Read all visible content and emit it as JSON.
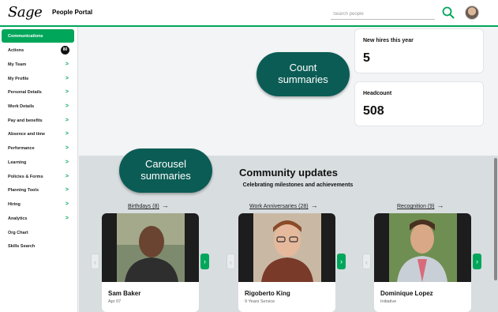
{
  "header": {
    "logo": "Sage",
    "app_name": "People Portal",
    "search_placeholder": "Search people"
  },
  "sidebar": {
    "items": [
      {
        "label": "Communications",
        "active": true
      },
      {
        "label": "Actions",
        "badge": "80"
      },
      {
        "label": "My Team",
        "chevron": ">"
      },
      {
        "label": "My Profile",
        "chevron": ">"
      },
      {
        "label": "Personal Details",
        "chevron": ">"
      },
      {
        "label": "Work Details",
        "chevron": ">"
      },
      {
        "label": "Pay and benefits",
        "chevron": ">"
      },
      {
        "label": "Absence and time",
        "chevron": ">"
      },
      {
        "label": "Performance",
        "chevron": ">"
      },
      {
        "label": "Learning",
        "chevron": ">"
      },
      {
        "label": "Policies & Forms",
        "chevron": ">"
      },
      {
        "label": "Planning Tools",
        "chevron": ">"
      },
      {
        "label": "Hiring",
        "chevron": ">"
      },
      {
        "label": "Analytics",
        "chevron": ">"
      },
      {
        "label": "Org Chart"
      },
      {
        "label": "Skills Search"
      }
    ]
  },
  "stats": {
    "new_hires": {
      "label": "New hires this year",
      "value": "5"
    },
    "headcount": {
      "label": "Headcount",
      "value": "508"
    }
  },
  "callouts": {
    "count": [
      "Count",
      "summaries"
    ],
    "carousel": [
      "Carousel",
      "summaries"
    ]
  },
  "community": {
    "title": "Community updates",
    "subtitle": "Celebrating milestones and achievements",
    "columns": [
      {
        "link": "Birthdays (8)",
        "arrow": "→",
        "name": "Sam Baker",
        "sub": "Apr 07"
      },
      {
        "link": "Work Anniversaries (28)",
        "arrow": "→",
        "name": "Rigoberto King",
        "sub": "9 Years Service"
      },
      {
        "link": "Recognition (9)",
        "arrow": "→",
        "name": "Dominique Lopez",
        "sub": "Initiative"
      }
    ],
    "prev_glyph": "‹",
    "next_glyph": "›"
  },
  "colors": {
    "brand_green": "#00a65a",
    "callout_teal": "#0b5c55",
    "section_bg": "#d8dde0"
  }
}
